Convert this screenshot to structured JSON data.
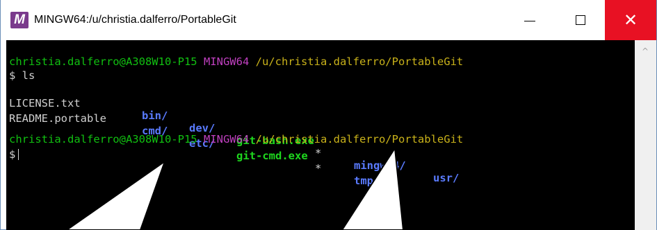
{
  "window": {
    "title": "MINGW64:/u/christia.dalferro/PortableGit",
    "icon_letter": "M",
    "icon": "mingw-app-icon",
    "controls": {
      "minimize": "minimize-icon",
      "maximize": "maximize-icon",
      "close": "close-icon",
      "close_glyph": "✕",
      "close_color": "#e81123"
    }
  },
  "terminal": {
    "prompt1": {
      "user_host": "christia.dalferro@A308W10-P15",
      "shell": "MINGW64",
      "path": "/u/christia.dalferro/PortableGit"
    },
    "command_line": "$ ls",
    "listing": {
      "row1": [
        "LICENSE.txt",
        "bin/",
        "dev/",
        "git-bash.exe",
        "*",
        "mingw64/",
        "usr/"
      ],
      "row2": [
        "README.portable",
        "cmd/",
        "etc/",
        "git-cmd.exe",
        "*",
        "tmp/"
      ]
    },
    "prompt2": {
      "user_host": "christia.dalferro@A308W10-P15",
      "shell": "MINGW64",
      "path": "/u/christia.dalferro/PortableGit"
    },
    "input_prompt": "$",
    "colors": {
      "background": "#000000",
      "user_host": "#11c011",
      "shell": "#c040c0",
      "path": "#c9b21a",
      "directory": "#5a7bff",
      "executable": "#1ed61e"
    }
  },
  "scrollbar": {
    "up_arrow": "^"
  }
}
